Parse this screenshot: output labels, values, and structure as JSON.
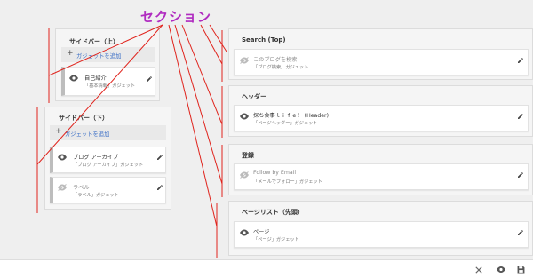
{
  "annotation": {
    "title": "セクション"
  },
  "sidebar_top": {
    "title": "サイドバー（上）",
    "add_label": "ガジェットを追加",
    "gadgets": [
      {
        "name": "自己紹介",
        "type": "「基本情報」ガジェット",
        "visible": true
      }
    ]
  },
  "sidebar_bottom": {
    "title": "サイドバー（下）",
    "add_label": "ガジェットを追加",
    "gadgets": [
      {
        "name": "ブログ アーカイブ",
        "type": "「ブログ アーカイブ」ガジェット",
        "visible": true
      },
      {
        "name": "ラベル",
        "type": "「ラベル」ガジェット",
        "visible": false
      }
    ]
  },
  "right_sections": [
    {
      "title": "Search (Top)",
      "gadget": {
        "name": "このブログを検索",
        "type": "「ブログ検索」ガジェット",
        "visible": false
      }
    },
    {
      "title": "ヘッダー",
      "gadget": {
        "name": "探ち食事ｌｉｆｅ！ (Header)",
        "type": "「ページヘッダー」ガジェット",
        "visible": true
      }
    },
    {
      "title": "登録",
      "gadget": {
        "name": "Follow by Email",
        "type": "「メールでフォロー」ガジェット",
        "visible": false
      }
    },
    {
      "title": "ページリスト（先頭）",
      "gadget": {
        "name": "ページ",
        "type": "「ページ」ガジェット",
        "visible": true
      }
    }
  ],
  "bottom_bar": {
    "icons": [
      "close-icon",
      "eye-icon",
      "save-icon"
    ]
  },
  "colors": {
    "annotation": "#b02cc0",
    "annotation_lines": "#e0231c",
    "link": "#3c6fc6"
  }
}
